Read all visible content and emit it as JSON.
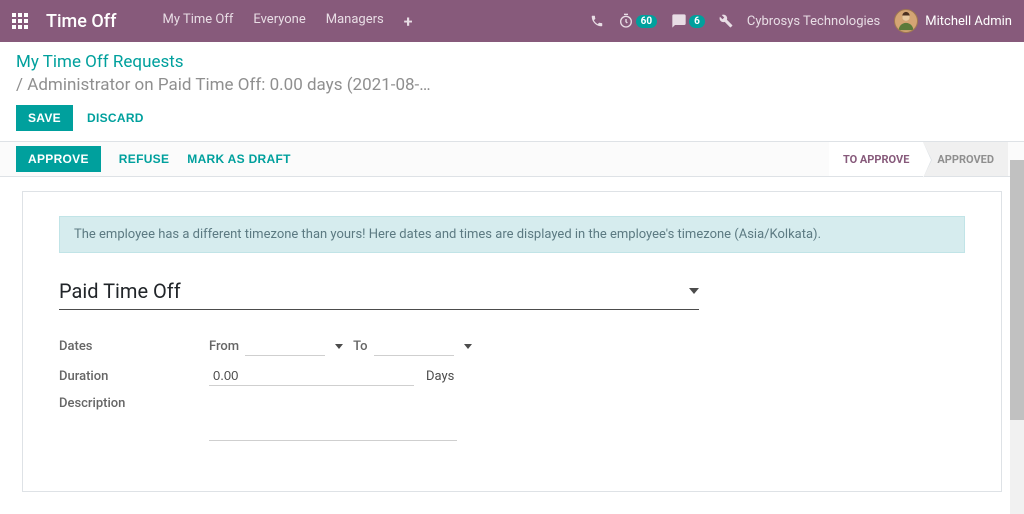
{
  "navbar": {
    "app_title": "Time Off",
    "menu": [
      "My Time Off",
      "Everyone",
      "Managers"
    ],
    "timer_badge": "60",
    "chat_badge": "6",
    "company": "Cybrosys Technologies",
    "user_name": "Mitchell Admin"
  },
  "breadcrumb": {
    "top": "My Time Off Requests",
    "bottom": "/ Administrator on Paid Time Off: 0.00 days (2021-08-…"
  },
  "actions": {
    "save": "SAVE",
    "discard": "DISCARD",
    "approve": "APPROVE",
    "refuse": "REFUSE",
    "mark_draft": "MARK AS DRAFT"
  },
  "status": {
    "to_approve": "TO APPROVE",
    "approved": "APPROVED"
  },
  "alert": "The employee has a different timezone than yours! Here dates and times are displayed in the employee's timezone (Asia/Kolkata).",
  "form": {
    "type_value": "Paid Time Off",
    "labels": {
      "dates": "Dates",
      "from": "From",
      "to": "To",
      "duration": "Duration",
      "days_unit": "Days",
      "description": "Description"
    },
    "values": {
      "from": "",
      "to": "",
      "duration": "0.00",
      "description": ""
    }
  }
}
